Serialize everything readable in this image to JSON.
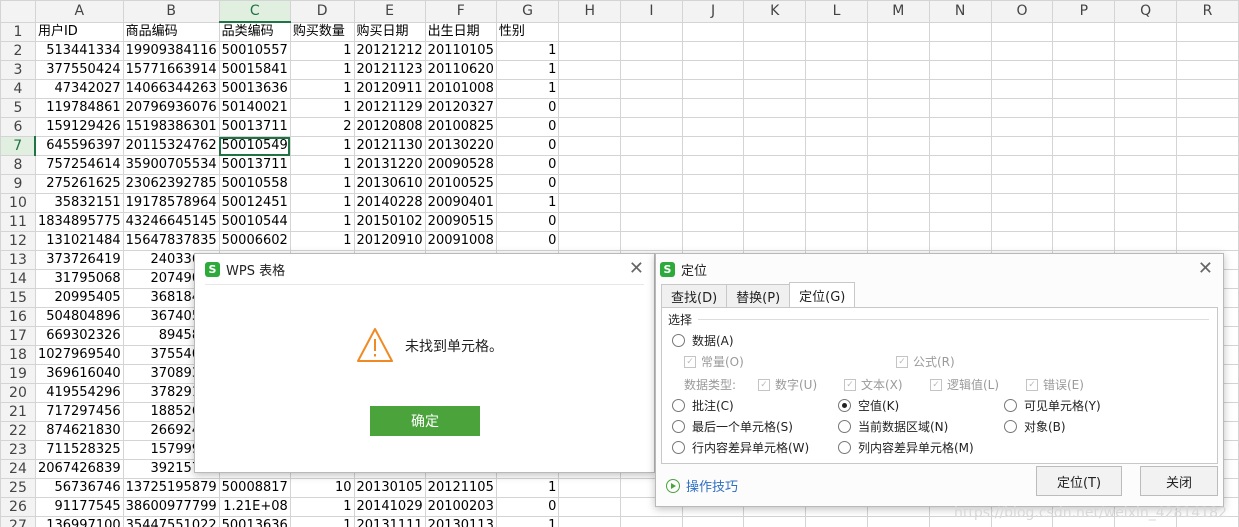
{
  "spreadsheet": {
    "columns": [
      "A",
      "B",
      "C",
      "D",
      "E",
      "F",
      "G",
      "H",
      "I",
      "J",
      "K",
      "L",
      "M",
      "N",
      "O",
      "P",
      "Q",
      "R"
    ],
    "active_column": "C",
    "active_row": 7,
    "headers": [
      "用户ID",
      "商品编码",
      "品类编码",
      "购买数量",
      "购买日期",
      "出生日期",
      "性别"
    ],
    "rows": [
      [
        "513441334",
        "19909384116",
        "50010557",
        "1",
        "20121212",
        "20110105",
        "1"
      ],
      [
        "377550424",
        "15771663914",
        "50015841",
        "1",
        "20121123",
        "20110620",
        "1"
      ],
      [
        "47342027",
        "14066344263",
        "50013636",
        "1",
        "20120911",
        "20101008",
        "1"
      ],
      [
        "119784861",
        "20796936076",
        "50140021",
        "1",
        "20121129",
        "20120327",
        "0"
      ],
      [
        "159129426",
        "15198386301",
        "50013711",
        "2",
        "20120808",
        "20100825",
        "0"
      ],
      [
        "645596397",
        "20115324762",
        "50010549",
        "1",
        "20121130",
        "20130220",
        "0"
      ],
      [
        "757254614",
        "35900705534",
        "50013711",
        "1",
        "20131220",
        "20090528",
        "0"
      ],
      [
        "275261625",
        "23062392785",
        "50010558",
        "1",
        "20130610",
        "20100525",
        "0"
      ],
      [
        "35832151",
        "19178578964",
        "50012451",
        "1",
        "20140228",
        "20090401",
        "1"
      ],
      [
        "1834895775",
        "43246645145",
        "50010544",
        "1",
        "20150102",
        "20090515",
        "0"
      ],
      [
        "131021484",
        "15647837835",
        "50006602",
        "1",
        "20120910",
        "20091008",
        "0"
      ],
      [
        "373726419",
        "24033632",
        "",
        "",
        "",
        "",
        ""
      ],
      [
        "31795068",
        "20749016",
        "",
        "",
        "",
        "",
        ""
      ],
      [
        "20995405",
        "36818435",
        "",
        "",
        "",
        "",
        ""
      ],
      [
        "504804896",
        "36740523",
        "",
        "",
        "",
        "",
        ""
      ],
      [
        "669302326",
        "8945822",
        "",
        "",
        "",
        "",
        ""
      ],
      [
        "1027969540",
        "37554024",
        "",
        "",
        "",
        "",
        ""
      ],
      [
        "369616040",
        "37089344",
        "",
        "",
        "",
        "",
        ""
      ],
      [
        "419554296",
        "37829194",
        "",
        "",
        "",
        "",
        ""
      ],
      [
        "717297456",
        "18852684",
        "",
        "",
        "",
        "",
        ""
      ],
      [
        "874621830",
        "26692404",
        "",
        "",
        "",
        "",
        ""
      ],
      [
        "711528325",
        "15799901",
        "",
        "",
        "",
        "",
        ""
      ],
      [
        "2067426839",
        "39215703",
        "",
        "",
        "",
        "",
        ""
      ],
      [
        "56736746",
        "13725195879",
        "50008817",
        "10",
        "20130105",
        "20121105",
        "1"
      ],
      [
        "91177545",
        "38600977799",
        "1.21E+08",
        "1",
        "20141029",
        "20100203",
        "0"
      ],
      [
        "136997100",
        "35447551022",
        "50013636",
        "1",
        "20131111",
        "20130113",
        "1"
      ]
    ]
  },
  "alert_dialog": {
    "logo": "S",
    "title": "WPS 表格",
    "message": "未找到单元格。",
    "ok_label": "确定",
    "close_glyph": "✕"
  },
  "goto_dialog": {
    "logo": "S",
    "title": "定位",
    "close_glyph": "✕",
    "tabs": [
      "查找(D)",
      "替换(P)",
      "定位(G)"
    ],
    "active_tab": "定位(G)",
    "group_label": "选择",
    "data_option": "数据(A)",
    "constants": "常量(O)",
    "formulas": "公式(R)",
    "data_types_label": "数据类型:",
    "types": [
      "数字(U)",
      "文本(X)",
      "逻辑值(L)",
      "错误(E)"
    ],
    "options": {
      "comments": "批注(C)",
      "blanks": "空值(K)",
      "visible_cells": "可见单元格(Y)",
      "last_cell": "最后一个单元格(S)",
      "current_region": "当前数据区域(N)",
      "objects": "对象(B)",
      "row_diff": "行内容差异单元格(W)",
      "col_diff": "列内容差异单元格(M)"
    },
    "selected_option": "空值(K)",
    "tips_label": "操作技巧",
    "locate_button": "定位(T)",
    "close_button": "关闭"
  },
  "watermark": "https://blog.csdn.net/weixin_42814182"
}
